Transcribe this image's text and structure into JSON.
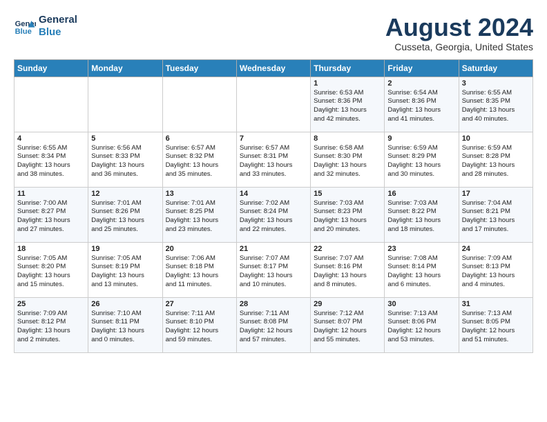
{
  "header": {
    "logo_line1": "General",
    "logo_line2": "Blue",
    "month": "August 2024",
    "location": "Cusseta, Georgia, United States"
  },
  "days_of_week": [
    "Sunday",
    "Monday",
    "Tuesday",
    "Wednesday",
    "Thursday",
    "Friday",
    "Saturday"
  ],
  "weeks": [
    [
      {
        "num": "",
        "info": ""
      },
      {
        "num": "",
        "info": ""
      },
      {
        "num": "",
        "info": ""
      },
      {
        "num": "",
        "info": ""
      },
      {
        "num": "1",
        "info": "Sunrise: 6:53 AM\nSunset: 8:36 PM\nDaylight: 13 hours\nand 42 minutes."
      },
      {
        "num": "2",
        "info": "Sunrise: 6:54 AM\nSunset: 8:36 PM\nDaylight: 13 hours\nand 41 minutes."
      },
      {
        "num": "3",
        "info": "Sunrise: 6:55 AM\nSunset: 8:35 PM\nDaylight: 13 hours\nand 40 minutes."
      }
    ],
    [
      {
        "num": "4",
        "info": "Sunrise: 6:55 AM\nSunset: 8:34 PM\nDaylight: 13 hours\nand 38 minutes."
      },
      {
        "num": "5",
        "info": "Sunrise: 6:56 AM\nSunset: 8:33 PM\nDaylight: 13 hours\nand 36 minutes."
      },
      {
        "num": "6",
        "info": "Sunrise: 6:57 AM\nSunset: 8:32 PM\nDaylight: 13 hours\nand 35 minutes."
      },
      {
        "num": "7",
        "info": "Sunrise: 6:57 AM\nSunset: 8:31 PM\nDaylight: 13 hours\nand 33 minutes."
      },
      {
        "num": "8",
        "info": "Sunrise: 6:58 AM\nSunset: 8:30 PM\nDaylight: 13 hours\nand 32 minutes."
      },
      {
        "num": "9",
        "info": "Sunrise: 6:59 AM\nSunset: 8:29 PM\nDaylight: 13 hours\nand 30 minutes."
      },
      {
        "num": "10",
        "info": "Sunrise: 6:59 AM\nSunset: 8:28 PM\nDaylight: 13 hours\nand 28 minutes."
      }
    ],
    [
      {
        "num": "11",
        "info": "Sunrise: 7:00 AM\nSunset: 8:27 PM\nDaylight: 13 hours\nand 27 minutes."
      },
      {
        "num": "12",
        "info": "Sunrise: 7:01 AM\nSunset: 8:26 PM\nDaylight: 13 hours\nand 25 minutes."
      },
      {
        "num": "13",
        "info": "Sunrise: 7:01 AM\nSunset: 8:25 PM\nDaylight: 13 hours\nand 23 minutes."
      },
      {
        "num": "14",
        "info": "Sunrise: 7:02 AM\nSunset: 8:24 PM\nDaylight: 13 hours\nand 22 minutes."
      },
      {
        "num": "15",
        "info": "Sunrise: 7:03 AM\nSunset: 8:23 PM\nDaylight: 13 hours\nand 20 minutes."
      },
      {
        "num": "16",
        "info": "Sunrise: 7:03 AM\nSunset: 8:22 PM\nDaylight: 13 hours\nand 18 minutes."
      },
      {
        "num": "17",
        "info": "Sunrise: 7:04 AM\nSunset: 8:21 PM\nDaylight: 13 hours\nand 17 minutes."
      }
    ],
    [
      {
        "num": "18",
        "info": "Sunrise: 7:05 AM\nSunset: 8:20 PM\nDaylight: 13 hours\nand 15 minutes."
      },
      {
        "num": "19",
        "info": "Sunrise: 7:05 AM\nSunset: 8:19 PM\nDaylight: 13 hours\nand 13 minutes."
      },
      {
        "num": "20",
        "info": "Sunrise: 7:06 AM\nSunset: 8:18 PM\nDaylight: 13 hours\nand 11 minutes."
      },
      {
        "num": "21",
        "info": "Sunrise: 7:07 AM\nSunset: 8:17 PM\nDaylight: 13 hours\nand 10 minutes."
      },
      {
        "num": "22",
        "info": "Sunrise: 7:07 AM\nSunset: 8:16 PM\nDaylight: 13 hours\nand 8 minutes."
      },
      {
        "num": "23",
        "info": "Sunrise: 7:08 AM\nSunset: 8:14 PM\nDaylight: 13 hours\nand 6 minutes."
      },
      {
        "num": "24",
        "info": "Sunrise: 7:09 AM\nSunset: 8:13 PM\nDaylight: 13 hours\nand 4 minutes."
      }
    ],
    [
      {
        "num": "25",
        "info": "Sunrise: 7:09 AM\nSunset: 8:12 PM\nDaylight: 13 hours\nand 2 minutes."
      },
      {
        "num": "26",
        "info": "Sunrise: 7:10 AM\nSunset: 8:11 PM\nDaylight: 13 hours\nand 0 minutes."
      },
      {
        "num": "27",
        "info": "Sunrise: 7:11 AM\nSunset: 8:10 PM\nDaylight: 12 hours\nand 59 minutes."
      },
      {
        "num": "28",
        "info": "Sunrise: 7:11 AM\nSunset: 8:08 PM\nDaylight: 12 hours\nand 57 minutes."
      },
      {
        "num": "29",
        "info": "Sunrise: 7:12 AM\nSunset: 8:07 PM\nDaylight: 12 hours\nand 55 minutes."
      },
      {
        "num": "30",
        "info": "Sunrise: 7:13 AM\nSunset: 8:06 PM\nDaylight: 12 hours\nand 53 minutes."
      },
      {
        "num": "31",
        "info": "Sunrise: 7:13 AM\nSunset: 8:05 PM\nDaylight: 12 hours\nand 51 minutes."
      }
    ]
  ]
}
